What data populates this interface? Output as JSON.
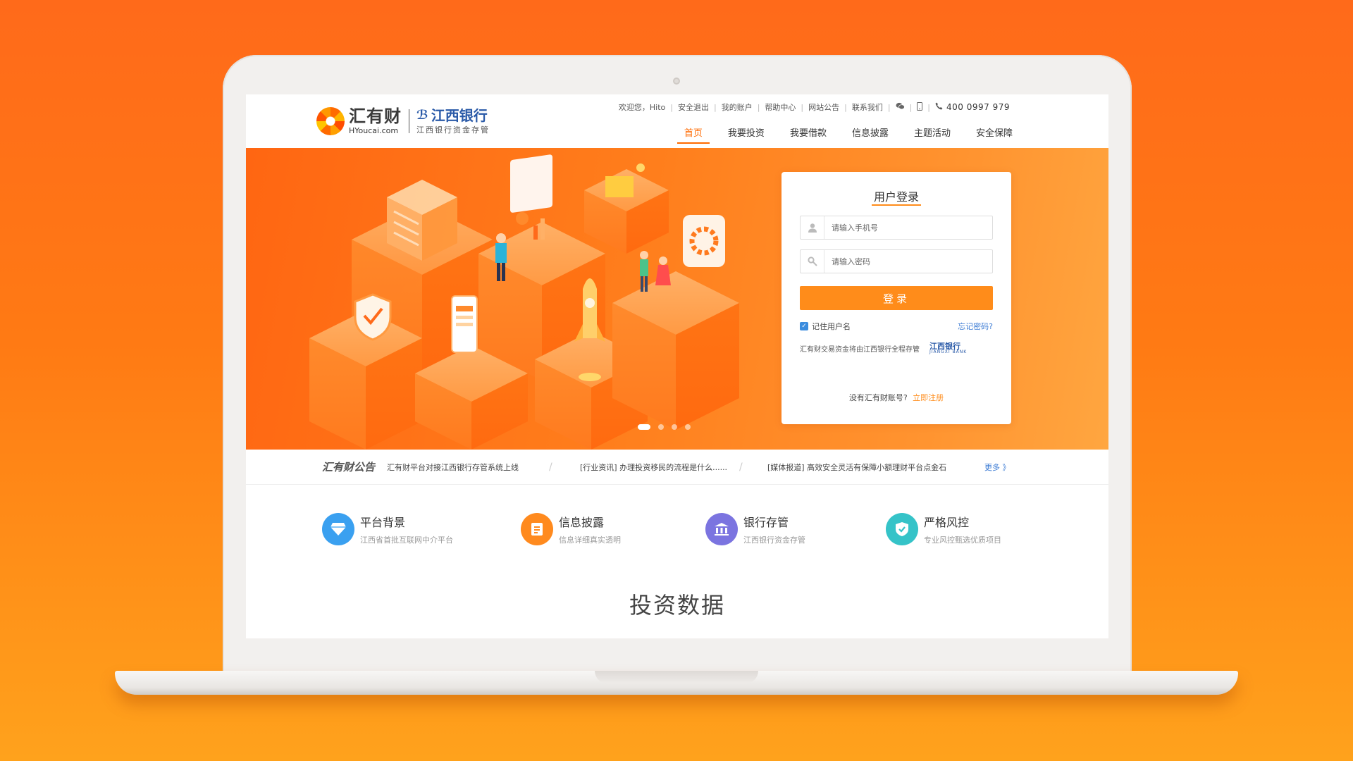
{
  "brand": {
    "name_cn": "汇有财",
    "name_en": "HYoucai.com",
    "bank_name": "江西银行",
    "bank_sub": "江西银行资金存管"
  },
  "top_links": {
    "welcome": "欢迎您，Hito",
    "logout": "安全退出",
    "account": "我的账户",
    "help": "帮助中心",
    "announcements": "网站公告",
    "contact": "联系我们",
    "phone": "400 0997 979"
  },
  "nav": {
    "items": [
      "首页",
      "我要投资",
      "我要借款",
      "信息披露",
      "主题活动",
      "安全保障"
    ]
  },
  "login": {
    "title": "用户登录",
    "phone_placeholder": "请输入手机号",
    "password_placeholder": "请输入密码",
    "submit": "登录",
    "remember": "记住用户名",
    "forgot": "忘记密码?",
    "custody_note": "汇有财交易资金将由江西银行全程存管",
    "custody_bank": "江西银行",
    "custody_bank_en": "JIANGXI BANK",
    "no_account": "没有汇有财账号?",
    "register": "立即注册"
  },
  "notice": {
    "title": "汇有财公告",
    "items": [
      "汇有财平台对接江西银行存管系统上线",
      "[行业资讯] 办理投资移民的流程是什么......",
      "[媒体报道] 高效安全灵活有保障小额理财平台点金石"
    ],
    "more": "更多 》"
  },
  "features": [
    {
      "title": "平台背景",
      "desc": "江西省首批互联网中介平台",
      "color": "#3aa0f0"
    },
    {
      "title": "信息披露",
      "desc": "信息详细真实透明",
      "color": "#ff8a1e"
    },
    {
      "title": "银行存管",
      "desc": "江西银行资金存管",
      "color": "#7b74e0"
    },
    {
      "title": "严格风控",
      "desc": "专业风控甄选优质项目",
      "color": "#35c3c8"
    }
  ],
  "section": {
    "title": "投资数据"
  },
  "colors": {
    "accent": "#ff6a00",
    "login_button": "#ff8c1a",
    "link": "#3b7bd4"
  }
}
